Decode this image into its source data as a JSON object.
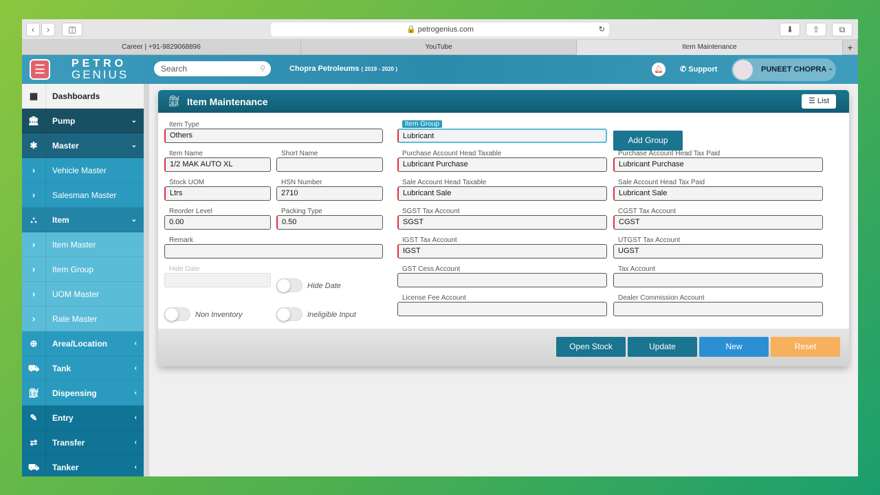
{
  "browser": {
    "url": "petrogenius.com",
    "tabs": [
      "Career | +91-9829068896",
      "YouTube",
      "Item Maintenance"
    ]
  },
  "header": {
    "logo_top": "PETRO",
    "logo_bottom": "GENIUS",
    "search_placeholder": "Search",
    "company": "Chopra Petroleums",
    "year": "( 2019 - 2020 )",
    "support": "Support",
    "user": "PUNEET CHOPRA"
  },
  "sidebar": {
    "items": [
      {
        "label": "Dashboards",
        "icon": "grid"
      },
      {
        "label": "Pump",
        "icon": "bank"
      },
      {
        "label": "Master",
        "icon": "asterisk"
      },
      {
        "label": "Vehicle Master"
      },
      {
        "label": "Salesman Master"
      },
      {
        "label": "Item",
        "icon": "cubes"
      },
      {
        "label": "Item Master"
      },
      {
        "label": "Item Group"
      },
      {
        "label": "UOM Master"
      },
      {
        "label": "Rate Master"
      },
      {
        "label": "Area/Location",
        "icon": "globe"
      },
      {
        "label": "Tank",
        "icon": "truck"
      },
      {
        "label": "Dispensing",
        "icon": "gas-pump"
      },
      {
        "label": "Entry",
        "icon": "edit"
      },
      {
        "label": "Transfer",
        "icon": "exchange"
      },
      {
        "label": "Tanker",
        "icon": "truck"
      }
    ]
  },
  "card": {
    "title": "Item Maintenance",
    "list_button": "List",
    "add_group": "Add Group"
  },
  "fields": {
    "item_type": {
      "label": "Item Type",
      "value": "Others"
    },
    "item_group": {
      "label": "Item Group",
      "value": "Lubricant"
    },
    "item_name": {
      "label": "Item Name",
      "value": "1/2 MAK AUTO XL"
    },
    "short_name": {
      "label": "Short Name",
      "value": ""
    },
    "stock_uom": {
      "label": "Stock UOM",
      "value": "Ltrs"
    },
    "hsn": {
      "label": "HSN Number",
      "value": "2710"
    },
    "reorder": {
      "label": "Reorder Level",
      "value": "0.00"
    },
    "packing": {
      "label": "Packing Type",
      "value": "0.50"
    },
    "remark": {
      "label": "Remark",
      "value": ""
    },
    "hide_date": {
      "label": "Hide Date",
      "value": ""
    },
    "pur_tax": {
      "label": "Purchase Account Head Taxable",
      "value": "Lubricant Purchase"
    },
    "pur_paid": {
      "label": "Purchase Account Head Tax Paid",
      "value": "Lubricant Purchase"
    },
    "sale_tax": {
      "label": "Sale Account Head Taxable",
      "value": "Lubricant Sale"
    },
    "sale_paid": {
      "label": "Sale Account Head Tax Paid",
      "value": "Lubricant Sale"
    },
    "sgst": {
      "label": "SGST Tax Account",
      "value": "SGST"
    },
    "cgst": {
      "label": "CGST Tax Account",
      "value": "CGST"
    },
    "igst": {
      "label": "IGST Tax Account",
      "value": "IGST"
    },
    "utgst": {
      "label": "UTGST Tax Account",
      "value": "UGST"
    },
    "cess": {
      "label": "GST Cess Account",
      "value": ""
    },
    "tax": {
      "label": "Tax Account",
      "value": ""
    },
    "license": {
      "label": "License Fee Account",
      "value": ""
    },
    "dealer": {
      "label": "Dealer Commission Account",
      "value": ""
    }
  },
  "toggles": {
    "hide_date": "Hide Date",
    "non_inventory": "Non Inventory",
    "ineligible": "Ineligible Input"
  },
  "buttons": {
    "open_stock": "Open Stock",
    "update": "Update",
    "new": "New",
    "reset": "Reset"
  },
  "colors": {
    "accent": "#1a7590",
    "new": "#2b8fd6",
    "reset": "#f7b05b",
    "required": "#d9323d"
  }
}
